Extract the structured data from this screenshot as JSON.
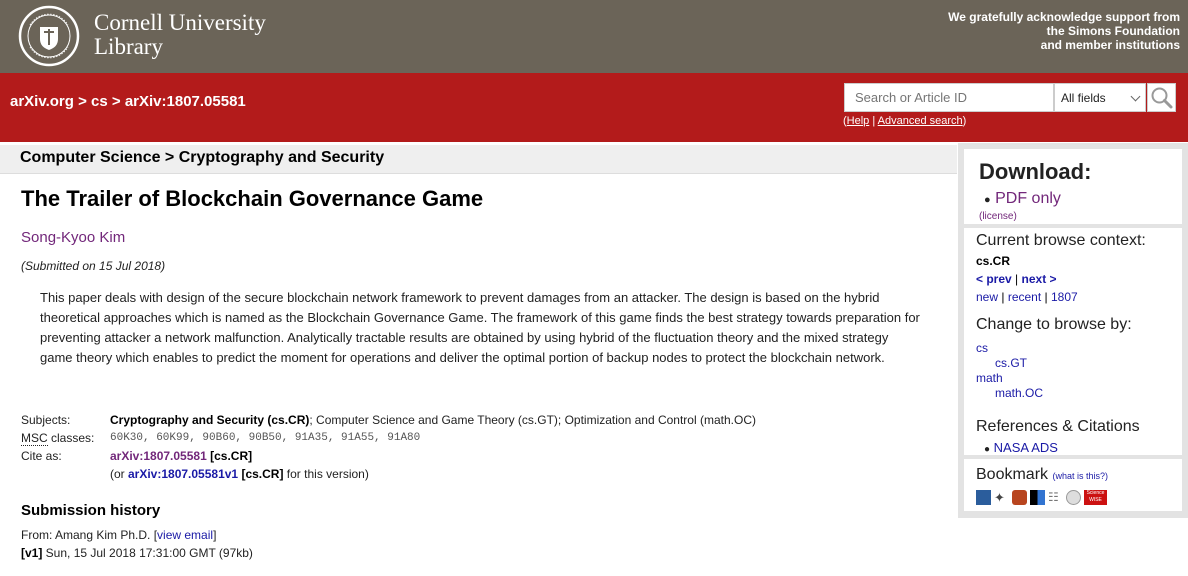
{
  "header": {
    "institution": "Cornell University",
    "library": "Library",
    "support_lines": [
      "We gratefully acknowledge support from",
      "the Simons Foundation",
      "and member institutions"
    ]
  },
  "nav": {
    "crumbs": [
      "arXiv.org",
      "cs",
      "arXiv:1807.05581"
    ],
    "separator": ">"
  },
  "search": {
    "placeholder": "Search or Article ID",
    "field_selected": "All fields",
    "help_label": "Help",
    "advanced_label": "Advanced search"
  },
  "subject_heading": "Computer Science > Cryptography and Security",
  "paper": {
    "title": "The Trailer of Blockchain Governance Game",
    "author": "Song-Kyoo Kim",
    "submitted": "(Submitted on 15 Jul 2018)",
    "abstract": "This paper deals with design of the secure blockchain network framework to prevent damages from an attacker. The design is based on the hybrid theoretical approaches which is named as the Blockchain Governance Game. The framework of this game finds the best strategy towards preparation for preventing attacker a network malfunction. Analytically tractable results are obtained by using hybrid of the fluctuation theory and the mixed strategy game theory which enables to predict the moment for operations and deliver the optimal portion of backup nodes to protect the blockchain network."
  },
  "meta": {
    "subjects_label": "Subjects:",
    "subjects_primary": "Cryptography and Security (cs.CR)",
    "subjects_rest": "; Computer Science and Game Theory (cs.GT); Optimization and Control (math.OC)",
    "msc_label_abbr": "MSC",
    "msc_label_rest": " classes:",
    "msc_values": "60K30, 60K99, 90B60, 90B50, 91A35, 91A55, 91A80",
    "cite_label": "Cite as:",
    "cite_id": "arXiv:1807.05581",
    "cite_cat": "[cs.CR]",
    "cite_or": "(or ",
    "cite_v1": "arXiv:1807.05581v1",
    "cite_v1_cat": "[cs.CR]",
    "cite_tail": " for this version)"
  },
  "history": {
    "title": "Submission history",
    "from_prefix": "From: Amang Kim Ph.D. [",
    "view_email": "view email",
    "from_suffix": "]",
    "v1_tag": "[v1]",
    "v1_text": " Sun, 15 Jul 2018 17:31:00 GMT (97kb)"
  },
  "sidebar": {
    "download_title": "Download:",
    "pdf_only": "PDF only",
    "license": "(license)",
    "browse_context_title": "Current browse context:",
    "browse_context": "cs.CR",
    "prev": "< prev",
    "next": "next >",
    "sep": "|",
    "new": "new",
    "recent": "recent",
    "year": "1807",
    "change_title": "Change to browse by:",
    "browse_cats": [
      "cs",
      "cs.GT",
      "math",
      "math.OC"
    ],
    "refs_title": "References & Citations",
    "nasa_ads": "NASA ADS",
    "bookmark_title": "Bookmark",
    "what_is_this": "(what is this?)",
    "science_wise": "Science WISE"
  },
  "colors": {
    "header_bg": "#6b6458",
    "red": "#b31b1b",
    "link": "#1a1aa6",
    "author_purple": "#72277a"
  }
}
